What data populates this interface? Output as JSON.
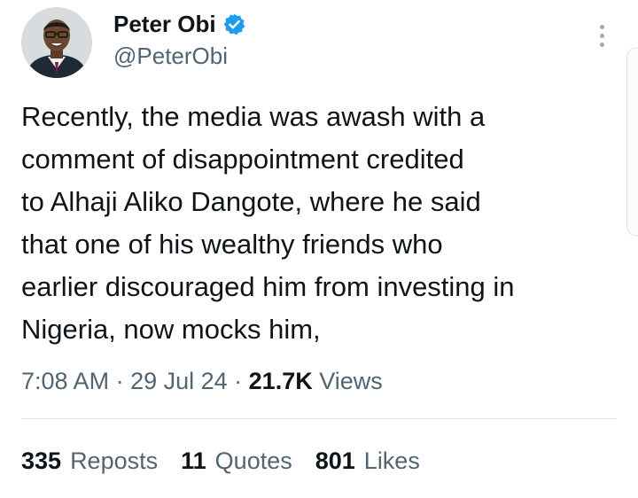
{
  "author": {
    "display_name": "Peter Obi",
    "handle": "@PeterObi",
    "avatar_icon": "profile-photo",
    "verified_icon": "verified-badge-icon",
    "verified_color": "#1d9bf0"
  },
  "menu_icon": "more-vertical-icon",
  "tweet": {
    "lines": [
      "Recently, the media was awash with a",
      "comment of disappointment credited",
      "to Alhaji Aliko Dangote, where he said",
      "that one of his wealthy friends who",
      "earlier discouraged him from investing in",
      "Nigeria, now mocks him,"
    ]
  },
  "meta": {
    "time": "7:08 AM",
    "sep1": " · ",
    "date": "29 Jul 24",
    "sep2": " · ",
    "views_count": "21.7K",
    "views_label": " Views"
  },
  "stats": {
    "reposts_count": "335",
    "reposts_label": "Reposts",
    "quotes_count": "11",
    "quotes_label": "Quotes",
    "likes_count": "801",
    "likes_label": "Likes"
  },
  "colors": {
    "primary_text": "#0f1419",
    "secondary_text": "#536471",
    "divider": "#dfe3e6"
  }
}
